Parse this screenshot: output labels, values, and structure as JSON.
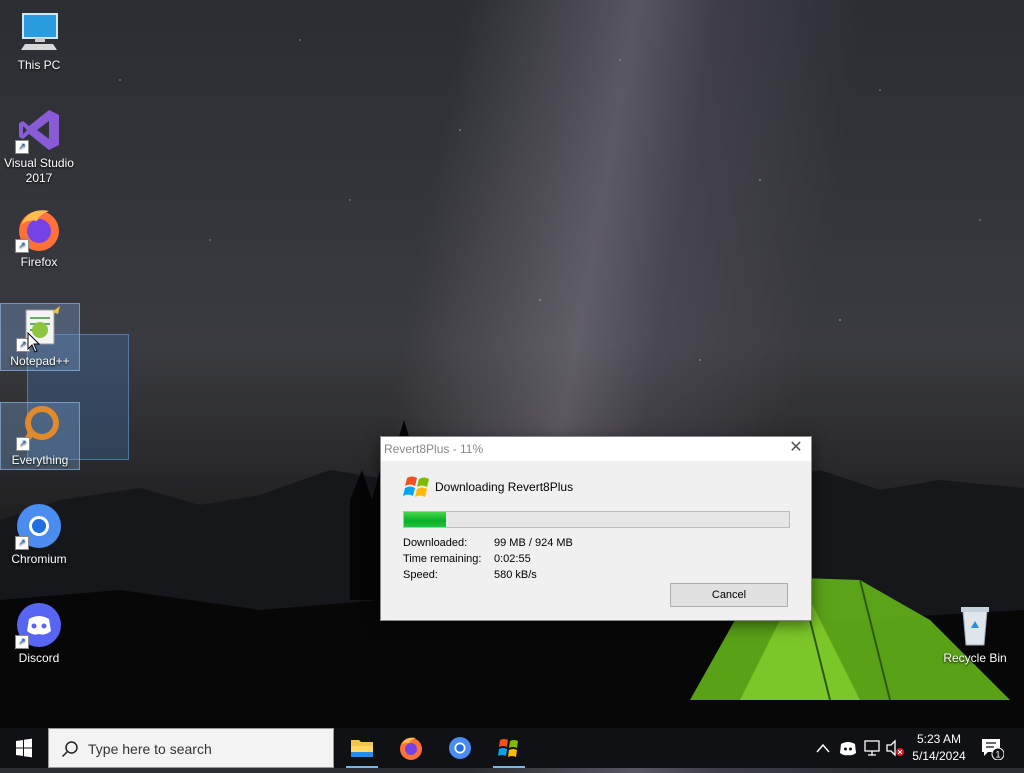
{
  "desktop": {
    "icons": [
      {
        "label": "This PC"
      },
      {
        "label": "Visual Studio 2017"
      },
      {
        "label": "Firefox"
      },
      {
        "label": "Notepad++"
      },
      {
        "label": "Everything"
      },
      {
        "label": "Chromium"
      },
      {
        "label": "Discord"
      },
      {
        "label": "Recycle Bin"
      }
    ]
  },
  "dialog": {
    "title": "Revert8Plus - 11%",
    "heading": "Downloading Revert8Plus",
    "progress_percent": 11,
    "downloaded_label": "Downloaded:",
    "downloaded_value": "99 MB / 924 MB",
    "time_label": "Time remaining:",
    "time_value": "0:02:55",
    "speed_label": "Speed:",
    "speed_value": "580 kB/s",
    "cancel_label": "Cancel",
    "close_glyph": "✕"
  },
  "taskbar": {
    "search_placeholder": "Type here to search",
    "clock_time": "5:23 AM",
    "clock_date": "5/14/2024",
    "notification_count": "1",
    "apps": [
      "file-explorer-icon",
      "firefox-icon",
      "chromium-icon",
      "windows-logo-icon"
    ]
  },
  "colors": {
    "progress_fill": "#06b025",
    "taskbar_bg": "#101114",
    "accent": "#76b9ed"
  }
}
